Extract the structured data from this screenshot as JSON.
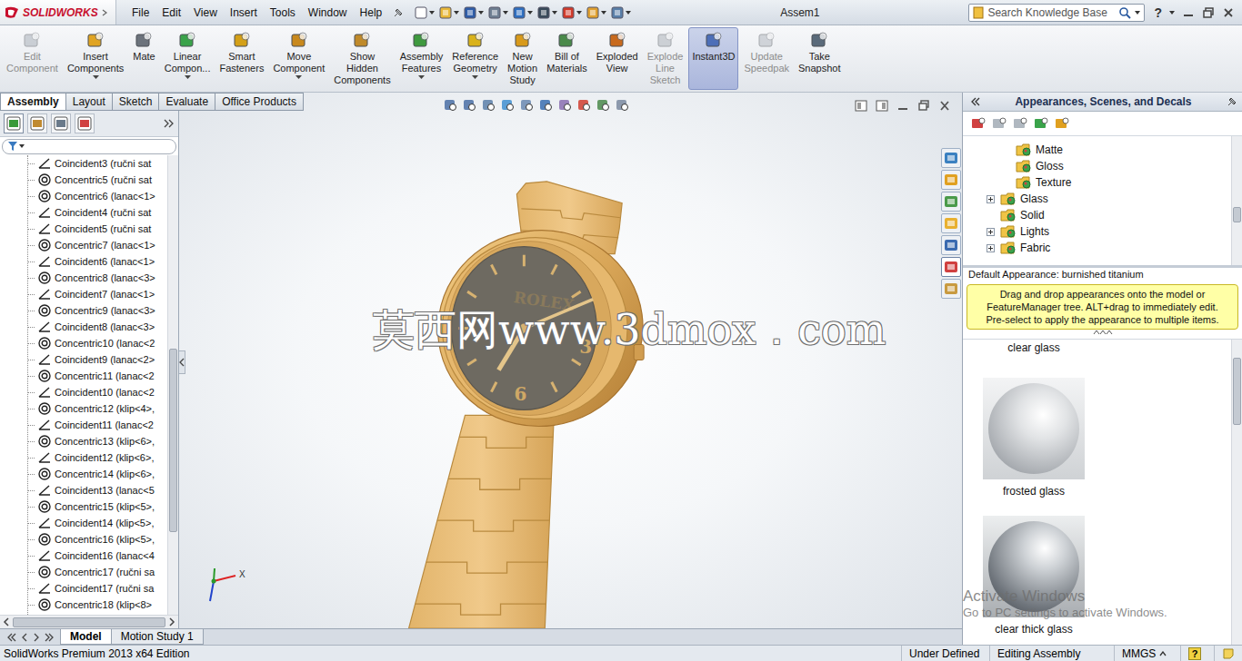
{
  "app": {
    "logo": "SOLIDWORKS",
    "title": "Assem1"
  },
  "menu": [
    "File",
    "Edit",
    "View",
    "Insert",
    "Tools",
    "Window",
    "Help"
  ],
  "search": {
    "placeholder": "Search Knowledge Base"
  },
  "help": "?",
  "command_buttons": [
    {
      "label": [
        "Edit",
        "Component"
      ],
      "disabled": true,
      "selected": false,
      "dropdown": false
    },
    {
      "label": [
        "Insert",
        "Components"
      ],
      "disabled": false,
      "selected": false,
      "dropdown": true
    },
    {
      "label": [
        "Mate"
      ],
      "disabled": false,
      "selected": false,
      "dropdown": false
    },
    {
      "label": [
        "Linear",
        "Compon..."
      ],
      "disabled": false,
      "selected": false,
      "dropdown": true
    },
    {
      "label": [
        "Smart",
        "Fasteners"
      ],
      "disabled": false,
      "selected": false,
      "dropdown": false
    },
    {
      "label": [
        "Move",
        "Component"
      ],
      "disabled": false,
      "selected": false,
      "dropdown": true
    },
    {
      "label": [
        "Show",
        "Hidden",
        "Components"
      ],
      "disabled": false,
      "selected": false,
      "dropdown": false
    },
    {
      "label": [
        "Assembly",
        "Features"
      ],
      "disabled": false,
      "selected": false,
      "dropdown": true
    },
    {
      "label": [
        "Reference",
        "Geometry"
      ],
      "disabled": false,
      "selected": false,
      "dropdown": true
    },
    {
      "label": [
        "New",
        "Motion",
        "Study"
      ],
      "disabled": false,
      "selected": false,
      "dropdown": false
    },
    {
      "label": [
        "Bill of",
        "Materials"
      ],
      "disabled": false,
      "selected": false,
      "dropdown": false
    },
    {
      "label": [
        "Exploded",
        "View"
      ],
      "disabled": false,
      "selected": false,
      "dropdown": false
    },
    {
      "label": [
        "Explode",
        "Line",
        "Sketch"
      ],
      "disabled": true,
      "selected": false,
      "dropdown": false
    },
    {
      "label": [
        "Instant3D"
      ],
      "disabled": false,
      "selected": true,
      "dropdown": false
    },
    {
      "label": [
        "Update",
        "Speedpak"
      ],
      "disabled": true,
      "selected": false,
      "dropdown": false
    },
    {
      "label": [
        "Take",
        "Snapshot"
      ],
      "disabled": false,
      "selected": false,
      "dropdown": false
    }
  ],
  "command_tabs": [
    {
      "label": "Assembly",
      "selected": true
    },
    {
      "label": "Layout",
      "selected": false
    },
    {
      "label": "Sketch",
      "selected": false
    },
    {
      "label": "Evaluate",
      "selected": false
    },
    {
      "label": "Office Products",
      "selected": false
    }
  ],
  "feature_tree": {
    "items": [
      {
        "label": "Coincident3 (ručni sat",
        "kind": "coincident"
      },
      {
        "label": "Concentric5 (ručni sat",
        "kind": "concentric"
      },
      {
        "label": "Concentric6 (lanac<1>",
        "kind": "concentric"
      },
      {
        "label": "Coincident4 (ručni sat",
        "kind": "coincident"
      },
      {
        "label": "Coincident5 (ručni sat",
        "kind": "coincident"
      },
      {
        "label": "Concentric7 (lanac<1>",
        "kind": "concentric"
      },
      {
        "label": "Coincident6 (lanac<1>",
        "kind": "coincident"
      },
      {
        "label": "Concentric8 (lanac<3>",
        "kind": "concentric"
      },
      {
        "label": "Coincident7 (lanac<1>",
        "kind": "coincident"
      },
      {
        "label": "Concentric9 (lanac<3>",
        "kind": "concentric"
      },
      {
        "label": "Coincident8 (lanac<3>",
        "kind": "coincident"
      },
      {
        "label": "Concentric10 (lanac<2",
        "kind": "concentric"
      },
      {
        "label": "Coincident9 (lanac<2>",
        "kind": "coincident"
      },
      {
        "label": "Concentric11 (lanac<2",
        "kind": "concentric"
      },
      {
        "label": "Coincident10 (lanac<2",
        "kind": "coincident"
      },
      {
        "label": "Concentric12 (klip<4>,",
        "kind": "concentric"
      },
      {
        "label": "Coincident11 (lanac<2",
        "kind": "coincident"
      },
      {
        "label": "Concentric13 (klip<6>,",
        "kind": "concentric"
      },
      {
        "label": "Coincident12 (klip<6>,",
        "kind": "coincident"
      },
      {
        "label": "Concentric14 (klip<6>,",
        "kind": "concentric"
      },
      {
        "label": "Coincident13 (lanac<5",
        "kind": "coincident"
      },
      {
        "label": "Concentric15 (klip<5>,",
        "kind": "concentric"
      },
      {
        "label": "Coincident14 (klip<5>,",
        "kind": "coincident"
      },
      {
        "label": "Concentric16 (klip<5>,",
        "kind": "concentric"
      },
      {
        "label": "Coincident16 (lanac<4",
        "kind": "coincident"
      },
      {
        "label": "Concentric17 (ručni sa",
        "kind": "concentric"
      },
      {
        "label": "Coincident17 (ručni sa",
        "kind": "coincident"
      },
      {
        "label": "Concentric18 (klip<8>",
        "kind": "concentric"
      }
    ],
    "scroll": {
      "start": 0.42,
      "size": 0.4
    }
  },
  "graphics": {
    "dial": {
      "brand": "ROLEX",
      "numerals": [
        "3",
        "6"
      ]
    },
    "watermark": "莫西网www.3dmox．com",
    "triad_label": "X"
  },
  "task_pane": {
    "title": "Appearances, Scenes, and Decals",
    "tree": [
      {
        "label": "Matte",
        "level": 2,
        "expandable": false,
        "expanded": false
      },
      {
        "label": "Gloss",
        "level": 2,
        "expandable": false,
        "expanded": false
      },
      {
        "label": "Texture",
        "level": 2,
        "expandable": false,
        "expanded": false
      },
      {
        "label": "Glass",
        "level": 1,
        "expandable": true,
        "expanded": false
      },
      {
        "label": "Solid",
        "level": 1,
        "expandable": false,
        "expanded": false
      },
      {
        "label": "Lights",
        "level": 1,
        "expandable": true,
        "expanded": false
      },
      {
        "label": "Fabric",
        "level": 1,
        "expandable": true,
        "expanded": false
      }
    ],
    "tree_scroll": {
      "start": 0.55,
      "size": 0.12
    },
    "default_appearance": "Default Appearance: burnished titanium",
    "tip": [
      "Drag and drop appearances onto the model or",
      "FeatureManager tree.  ALT+drag to immediately edit.",
      "Pre-select to apply the appearance to multiple items."
    ],
    "swatches": [
      {
        "label": "clear glass",
        "kind": "label"
      },
      {
        "label": "frosted glass",
        "kind": "frosted"
      },
      {
        "label": "clear thick glass",
        "kind": "thick"
      }
    ],
    "swatch_scroll": {
      "start": 0.06,
      "size": 0.22
    }
  },
  "activation": {
    "title": "Activate Windows",
    "subtitle": "Go to PC settings to activate Windows."
  },
  "bottom_tabs": [
    {
      "label": "Model",
      "selected": true
    },
    {
      "label": "Motion Study 1",
      "selected": false
    }
  ],
  "status_bar": {
    "edition": "SolidWorks Premium 2013 x64 Edition",
    "state": "Under Defined",
    "mode": "Editing Assembly",
    "units": "MMGS",
    "help": "?"
  }
}
